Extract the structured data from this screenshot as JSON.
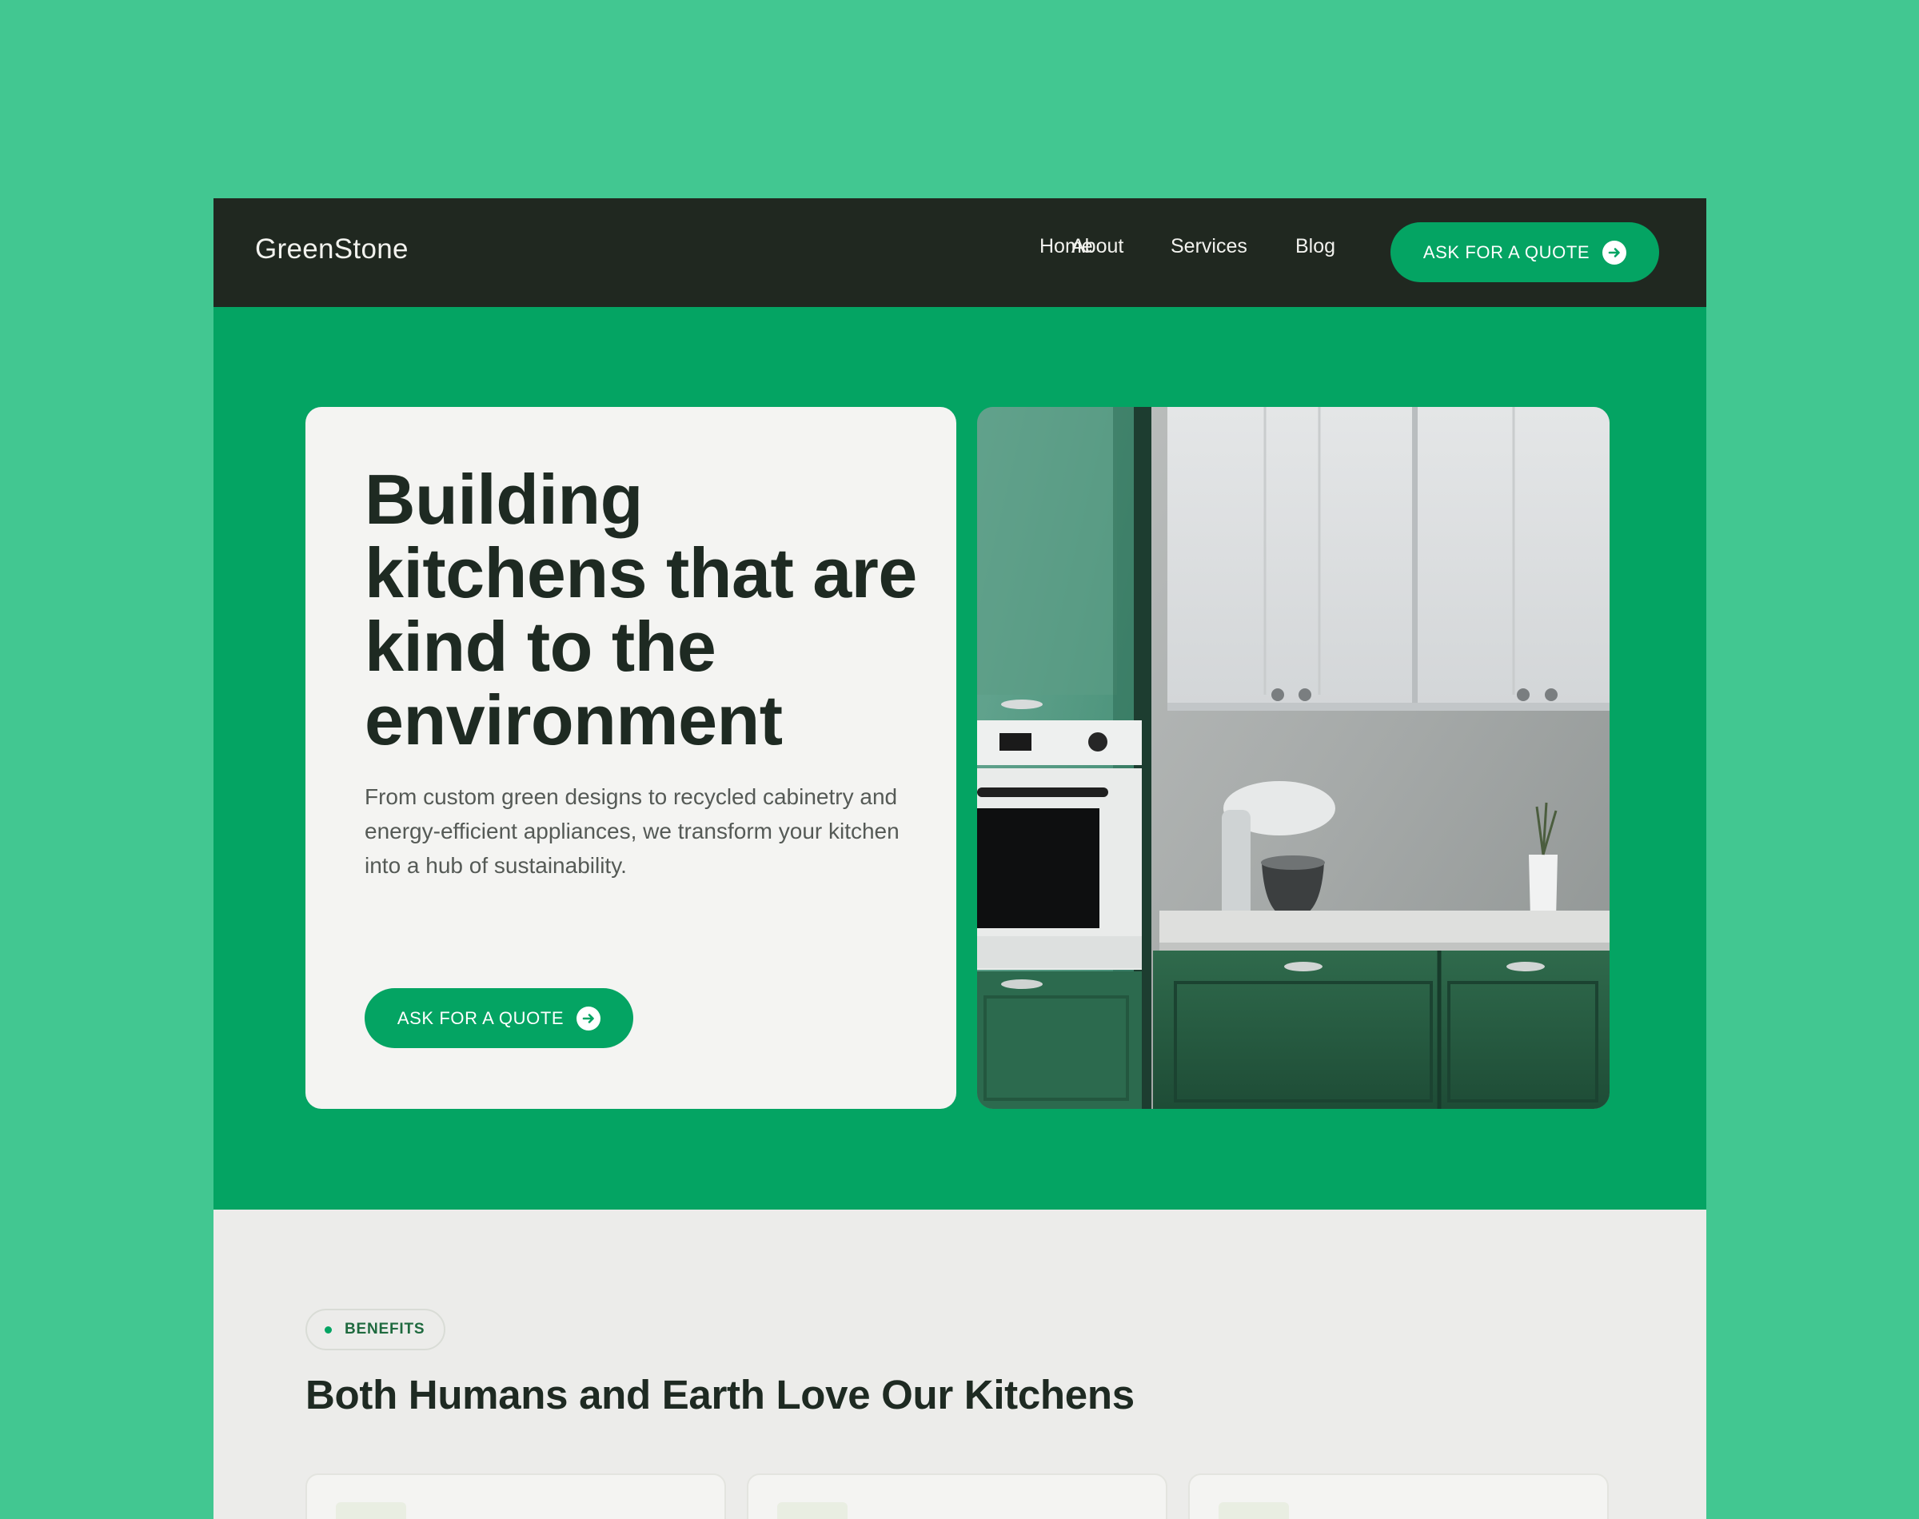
{
  "navbar": {
    "logo": "GreenStone",
    "links": [
      "Home",
      "About",
      "Services",
      "Blog"
    ],
    "cta_label": "ASK FOR A QUOTE"
  },
  "hero": {
    "title": "Building kitchens that are kind to the environment",
    "description": "From custom green designs to recycled cabinetry and energy-efficient appliances, we transform your kitchen into a hub of sustainability.",
    "cta_label": "ASK FOR A QUOTE",
    "image_alt": "green kitchen with white upper cabinets, oven and stand mixer"
  },
  "benefits": {
    "badge": "BENEFITS",
    "title": "Both Humans and Earth Love Our Kitchens",
    "cards": [
      {},
      {},
      {}
    ]
  },
  "colors": {
    "page_background": "#42c791",
    "nav_background": "#202820",
    "brand_green": "#04a463",
    "card_background": "#f4f4f2",
    "text_dark": "#1e2a22"
  },
  "icons": [
    "arrow-right-icon",
    "arrow-right-icon",
    "badge-dot-icon"
  ]
}
